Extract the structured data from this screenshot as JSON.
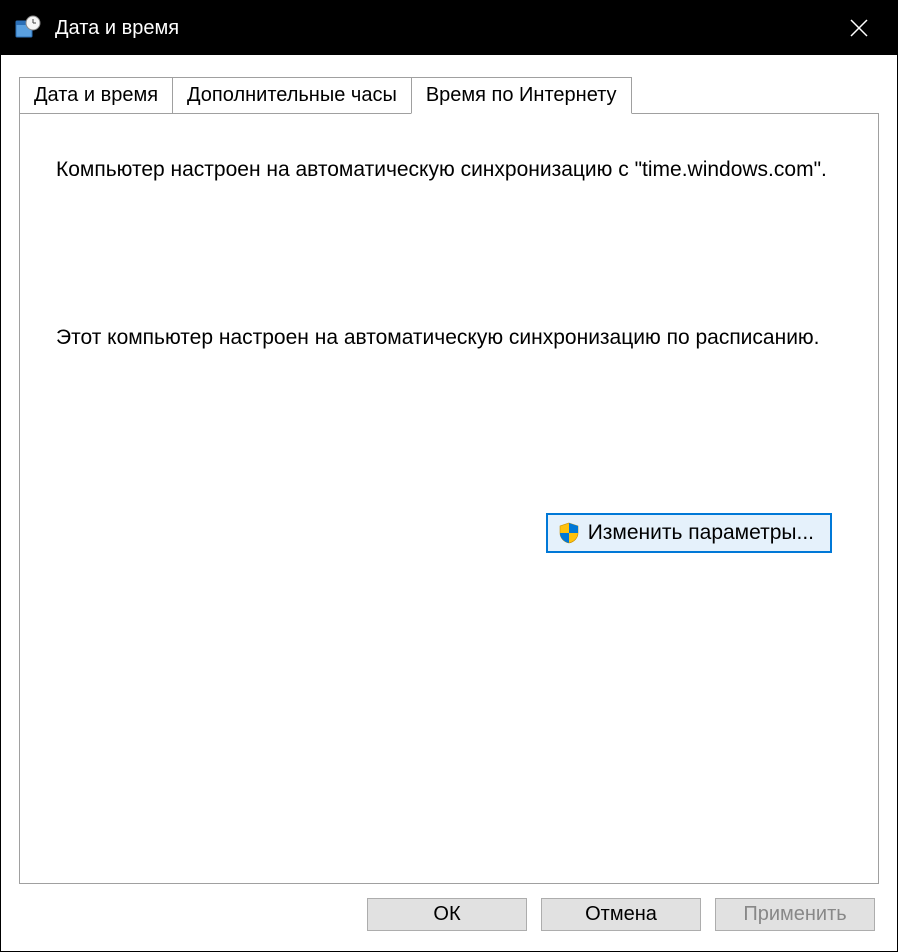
{
  "window": {
    "title": "Дата и время"
  },
  "tabs": {
    "date_time": "Дата и время",
    "additional_clocks": "Дополнительные часы",
    "internet_time": "Время по Интернету"
  },
  "content": {
    "sync_message": "Компьютер настроен на автоматическую синхронизацию с \"time.windows.com\".",
    "schedule_message": "Этот компьютер настроен на автоматическую синхронизацию по расписанию.",
    "change_settings_label": "Изменить параметры..."
  },
  "buttons": {
    "ok": "ОК",
    "cancel": "Отмена",
    "apply": "Применить"
  }
}
